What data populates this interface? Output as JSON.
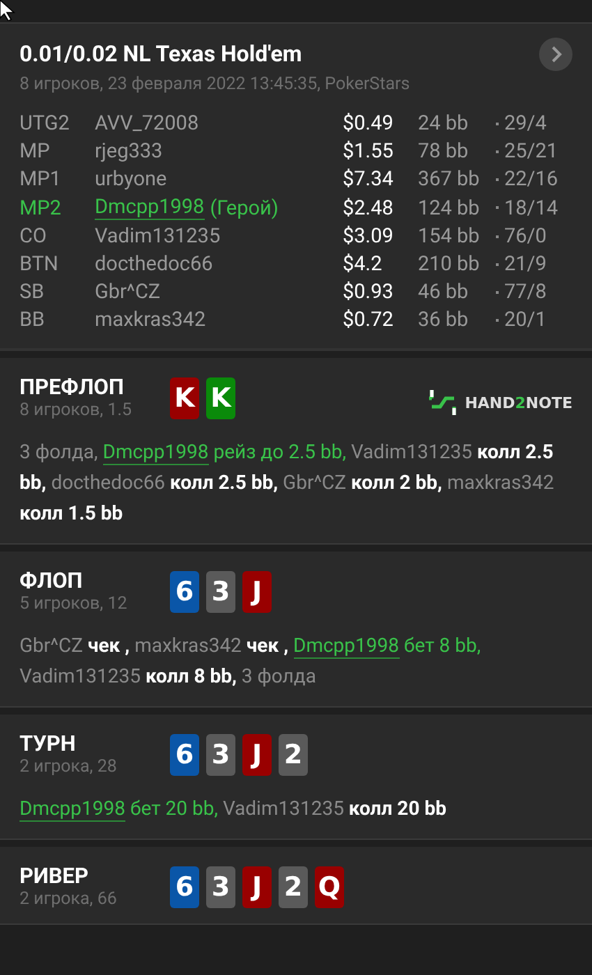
{
  "hand": {
    "title": "0.01/0.02 NL Texas Hold'em",
    "subtitle": "8 игроков, 23 февраля 2022 13:45:35, PokerStars"
  },
  "players": [
    {
      "position": "UTG2",
      "name": "AVV_72008",
      "hero": false,
      "stack": "$0.49",
      "bb": "24 bb",
      "stats": "29/4"
    },
    {
      "position": "MP",
      "name": "rjeg333",
      "hero": false,
      "stack": "$1.55",
      "bb": "78 bb",
      "stats": "25/21"
    },
    {
      "position": "MP1",
      "name": "urbyone",
      "hero": false,
      "stack": "$7.34",
      "bb": "367 bb",
      "stats": "22/16"
    },
    {
      "position": "MP2",
      "name": "Dmcpp1998",
      "hero": true,
      "hero_label": "(Герой)",
      "stack": "$2.48",
      "bb": "124 bb",
      "stats": "18/14"
    },
    {
      "position": "CO",
      "name": "Vadim131235",
      "hero": false,
      "stack": "$3.09",
      "bb": "154 bb",
      "stats": "76/0"
    },
    {
      "position": "BTN",
      "name": "docthedoc66",
      "hero": false,
      "stack": "$4.2",
      "bb": "210 bb",
      "stats": "21/9"
    },
    {
      "position": "SB",
      "name": "Gbr^CZ",
      "hero": false,
      "stack": "$0.93",
      "bb": "46 bb",
      "stats": "77/8"
    },
    {
      "position": "BB",
      "name": "maxkras342",
      "hero": false,
      "stack": "$0.72",
      "bb": "36 bb",
      "stats": "20/1"
    }
  ],
  "streets": [
    {
      "title": "ПРЕФЛОП",
      "subtitle": "8 игроков, 1.5",
      "cards": [
        {
          "rank": "K",
          "color": "#990000"
        },
        {
          "rank": "K",
          "color": "#0a8a0a"
        }
      ],
      "logo": {
        "head": "HAND",
        "accent": "2",
        "tail": "NOTE"
      },
      "log": [
        {
          "kind": "note",
          "text": "3 фолда, "
        },
        {
          "kind": "hero_player",
          "text": "Dmcpp1998"
        },
        {
          "kind": "hero_action",
          "text": " рейз до 2.5 bb, "
        },
        {
          "kind": "player",
          "text": "Vadim131235"
        },
        {
          "kind": "action",
          "text": " колл 2.5 bb, "
        },
        {
          "kind": "player",
          "text": "docthedoc66"
        },
        {
          "kind": "action",
          "text": " колл 2.5 bb, "
        },
        {
          "kind": "player",
          "text": "Gbr^CZ"
        },
        {
          "kind": "action",
          "text": " колл 2 bb, "
        },
        {
          "kind": "player",
          "text": "maxkras342"
        },
        {
          "kind": "action",
          "text": " колл 1.5 bb"
        }
      ]
    },
    {
      "title": "ФЛОП",
      "subtitle": "5 игроков, 12",
      "cards": [
        {
          "rank": "6",
          "color": "#0a56a8"
        },
        {
          "rank": "3",
          "color": "#5a5a5a"
        },
        {
          "rank": "J",
          "color": "#990000"
        }
      ],
      "log": [
        {
          "kind": "player",
          "text": "Gbr^CZ"
        },
        {
          "kind": "action",
          "text": " чек , "
        },
        {
          "kind": "player",
          "text": "maxkras342"
        },
        {
          "kind": "action",
          "text": " чек , "
        },
        {
          "kind": "hero_player",
          "text": "Dmcpp1998"
        },
        {
          "kind": "hero_action",
          "text": " бет 8 bb, "
        },
        {
          "kind": "player",
          "text": "Vadim131235"
        },
        {
          "kind": "action",
          "text": " колл 8 bb, "
        },
        {
          "kind": "note",
          "text": "3 фолда"
        }
      ]
    },
    {
      "title": "ТУРН",
      "subtitle": "2 игрока, 28",
      "cards": [
        {
          "rank": "6",
          "color": "#0a56a8"
        },
        {
          "rank": "3",
          "color": "#5a5a5a"
        },
        {
          "rank": "J",
          "color": "#990000"
        },
        {
          "rank": "2",
          "color": "#5a5a5a"
        }
      ],
      "log": [
        {
          "kind": "hero_player",
          "text": "Dmcpp1998"
        },
        {
          "kind": "hero_action",
          "text": " бет 20 bb, "
        },
        {
          "kind": "player",
          "text": "Vadim131235"
        },
        {
          "kind": "action",
          "text": " колл 20 bb"
        }
      ]
    },
    {
      "title": "РИВЕР",
      "subtitle": "2 игрока, 66",
      "cards": [
        {
          "rank": "6",
          "color": "#0a56a8"
        },
        {
          "rank": "3",
          "color": "#5a5a5a"
        },
        {
          "rank": "J",
          "color": "#990000"
        },
        {
          "rank": "2",
          "color": "#5a5a5a"
        },
        {
          "rank": "Q",
          "color": "#990000"
        }
      ]
    }
  ]
}
